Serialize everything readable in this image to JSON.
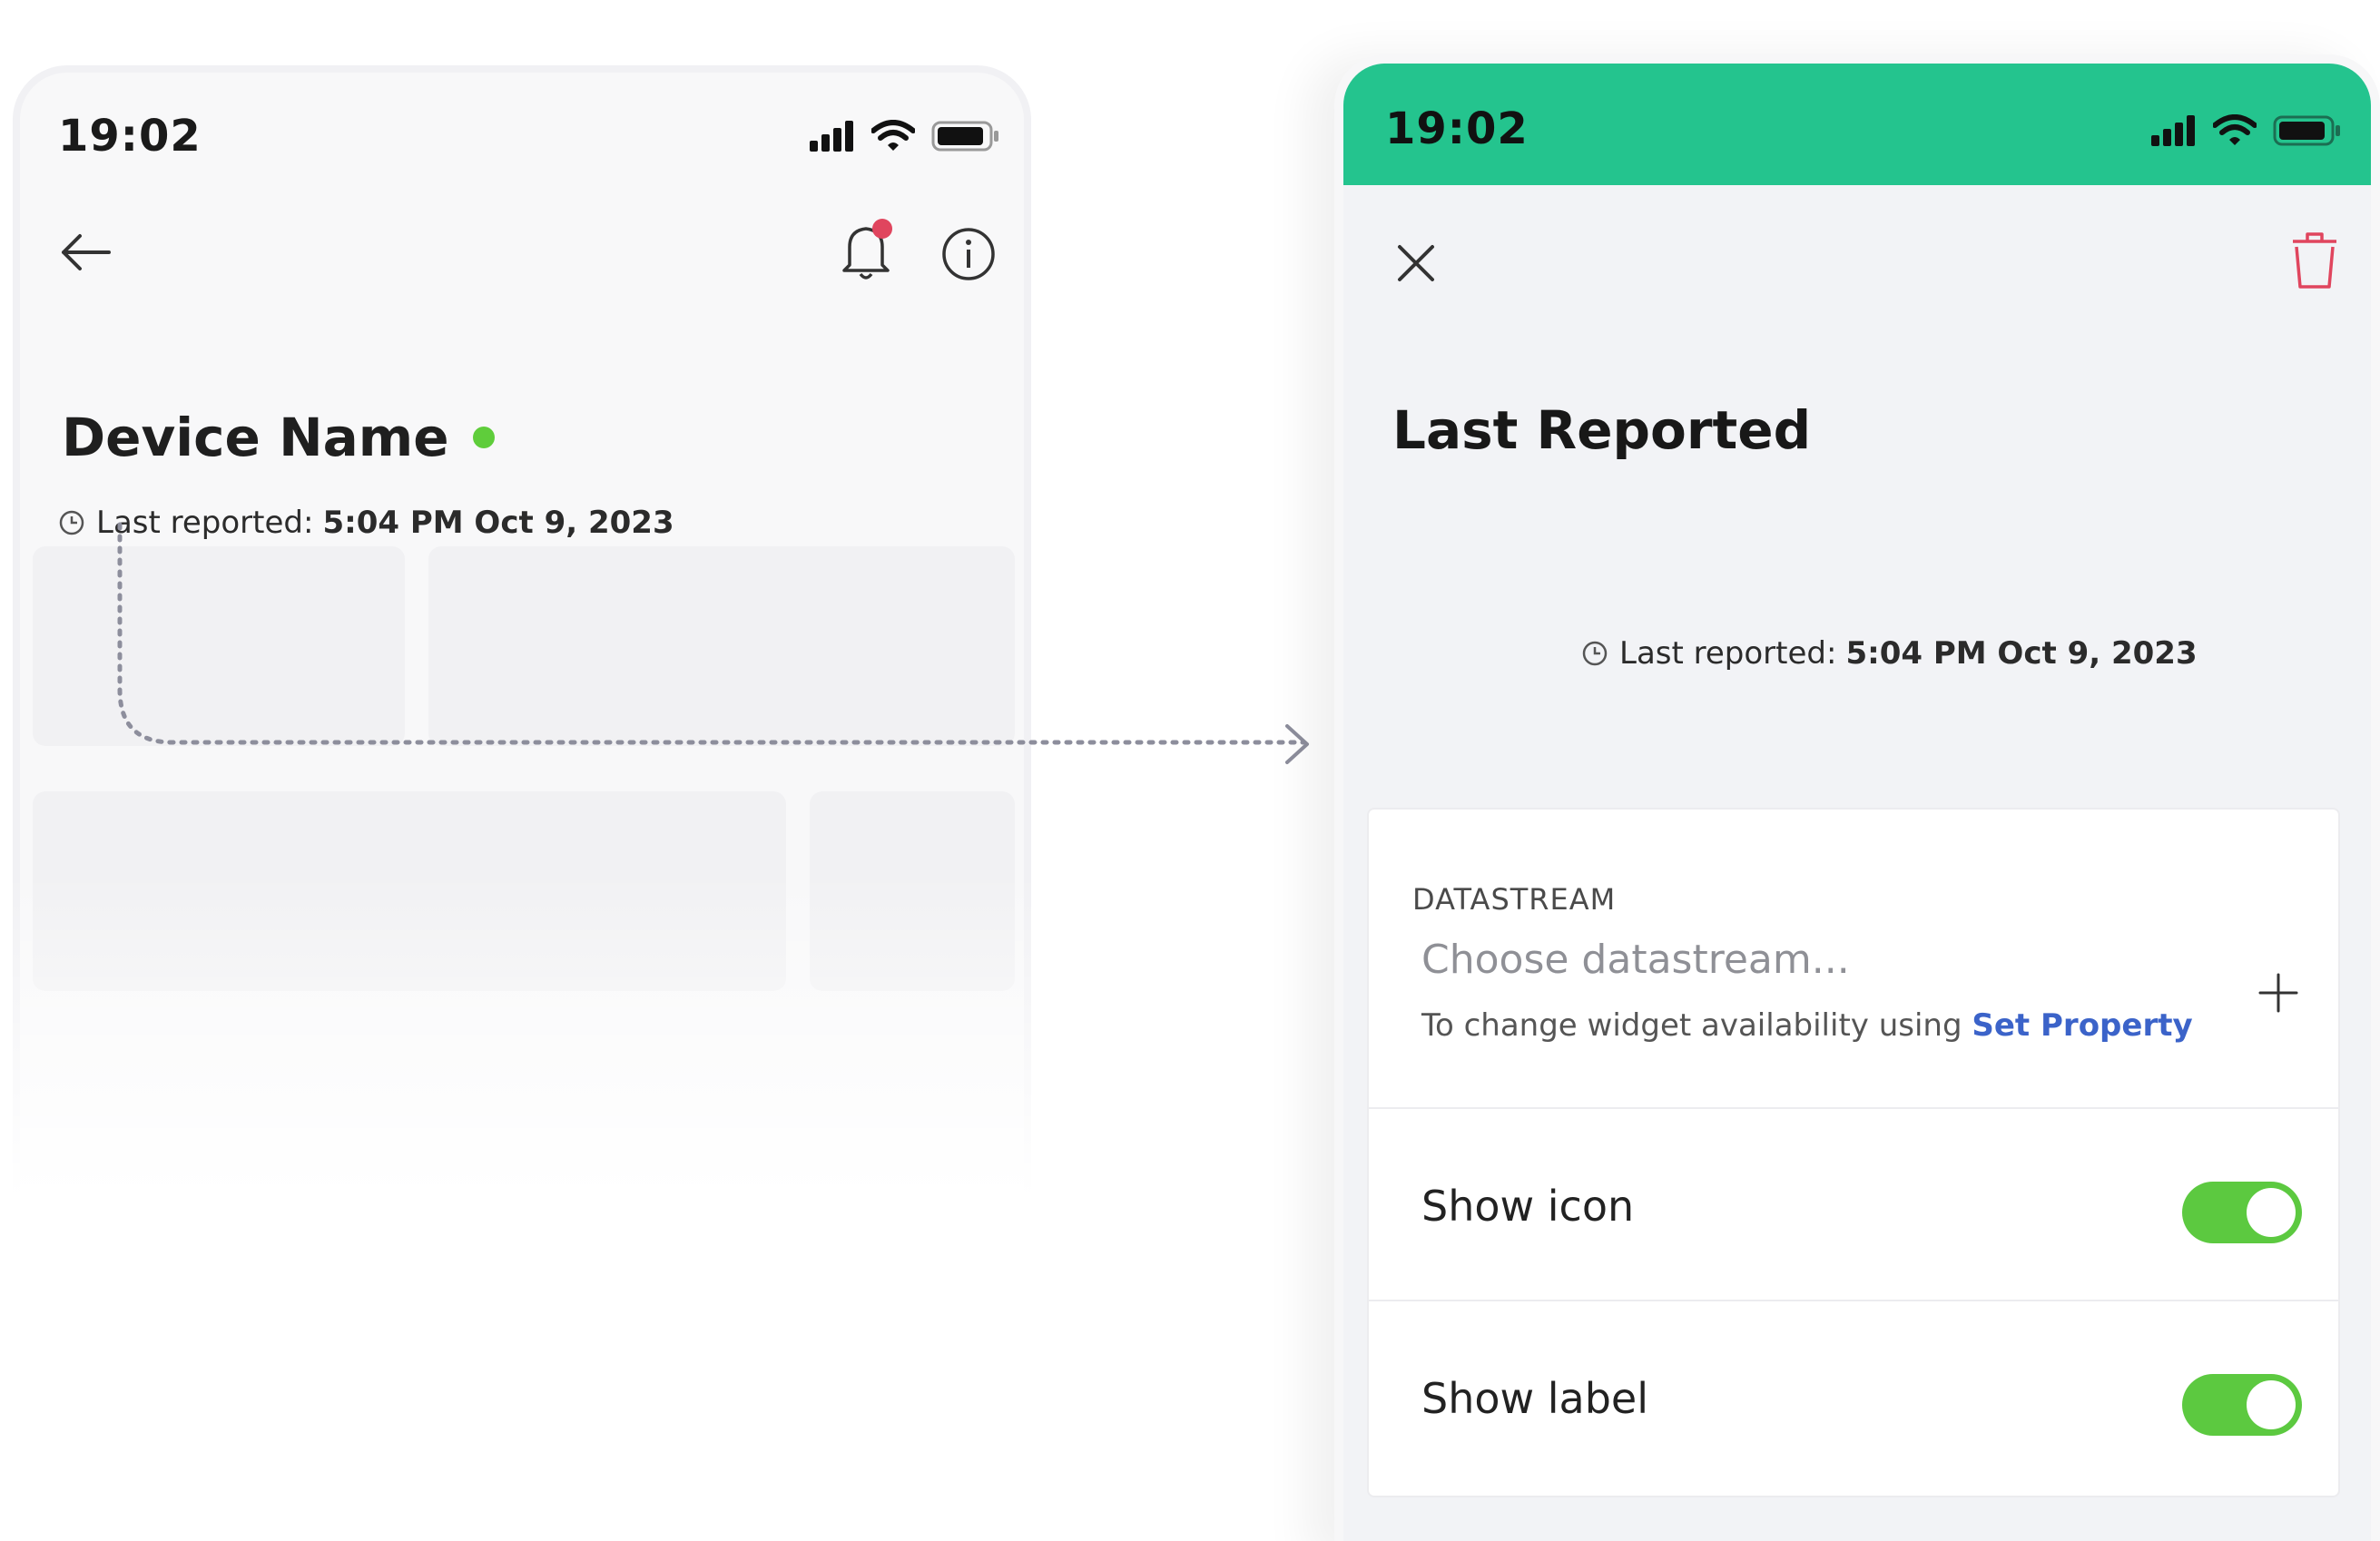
{
  "left_screen": {
    "status_time": "19:02",
    "device_name": "Device Name",
    "reported_label": "Last reported:",
    "reported_value": "5:04 PM Oct 9, 2023",
    "icons": [
      "back-arrow-icon",
      "bell-icon",
      "notification-dot",
      "info-icon",
      "clock-icon",
      "signal-icon",
      "wifi-icon",
      "battery-icon"
    ]
  },
  "right_screen": {
    "status_time": "19:02",
    "title": "Last Reported",
    "reported_label": "Last reported:",
    "reported_value": "5:04 PM Oct 9, 2023",
    "datastream": {
      "caption": "DATASTREAM",
      "placeholder": "Choose datastream...",
      "help_text": "To change widget availability using",
      "help_link": "Set Property"
    },
    "settings": [
      {
        "label": "Show icon",
        "enabled": true
      },
      {
        "label": "Show label",
        "enabled": true
      }
    ],
    "icons": [
      "close-icon",
      "trash-icon",
      "plus-icon",
      "clock-icon"
    ]
  },
  "colors": {
    "status_bar_green": "#24c48e",
    "toggle_on": "#5cc940",
    "link": "#3b63c9",
    "trash": "#e0455e",
    "online": "#5fcd3b",
    "notification": "#e0455e"
  }
}
